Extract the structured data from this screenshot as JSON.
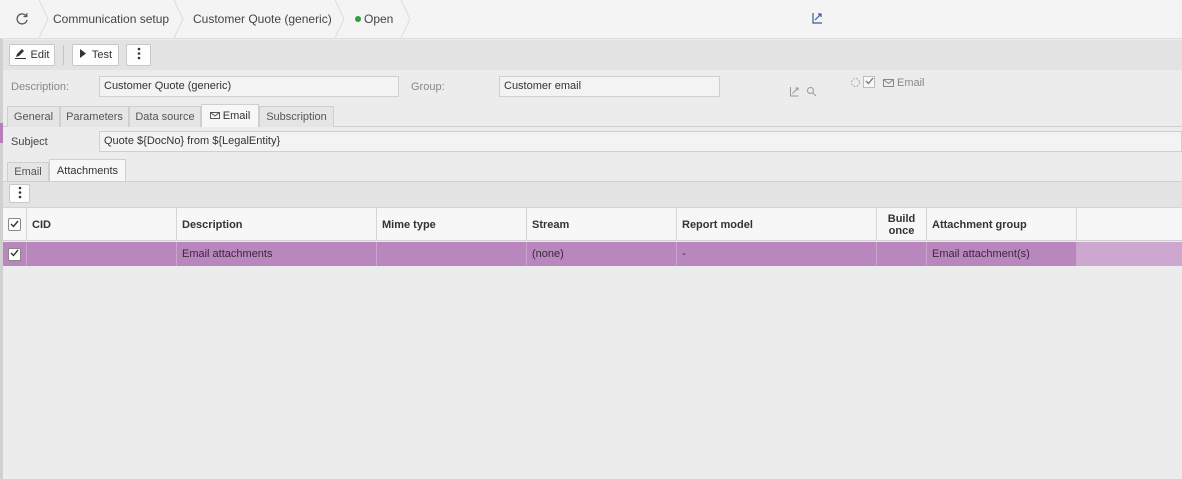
{
  "breadcrumb": {
    "items": [
      "Communication setup",
      "Customer Quote (generic)"
    ],
    "status": "Open"
  },
  "toolbar": {
    "edit_label": "Edit",
    "test_label": "Test"
  },
  "form": {
    "description_label": "Description:",
    "description_value": "Customer Quote (generic)",
    "group_label": "Group:",
    "group_value": "Customer email",
    "email_flag_label": "Email"
  },
  "tabs": [
    {
      "label": "General"
    },
    {
      "label": "Parameters"
    },
    {
      "label": "Data source"
    },
    {
      "label": "Email",
      "active": true
    },
    {
      "label": "Subscription"
    }
  ],
  "subject": {
    "label": "Subject",
    "value": "Quote ${DocNo} from ${LegalEntity}"
  },
  "subtabs": [
    {
      "label": "Email"
    },
    {
      "label": "Attachments",
      "active": true
    }
  ],
  "grid": {
    "columns": [
      "CID",
      "Description",
      "Mime type",
      "Stream",
      "Report model",
      "Build once",
      "Attachment group"
    ],
    "rows": [
      {
        "selected": true,
        "cid": "",
        "description": "Email attachments",
        "mime_type": "",
        "stream": "(none)",
        "report_model": "-",
        "build_once": "",
        "attachment_group": "Email attachment(s)"
      }
    ]
  },
  "colors": {
    "accent": "#b987bd",
    "status_green": "#2e9e3e",
    "background": "#ececec"
  },
  "icons": {
    "refresh": "refresh-icon",
    "edit": "pencil-icon",
    "test": "play-icon",
    "more": "more-vertical-icon",
    "pin": "pin-icon",
    "search": "search-icon",
    "envelope": "envelope-icon",
    "check": "check-icon"
  }
}
